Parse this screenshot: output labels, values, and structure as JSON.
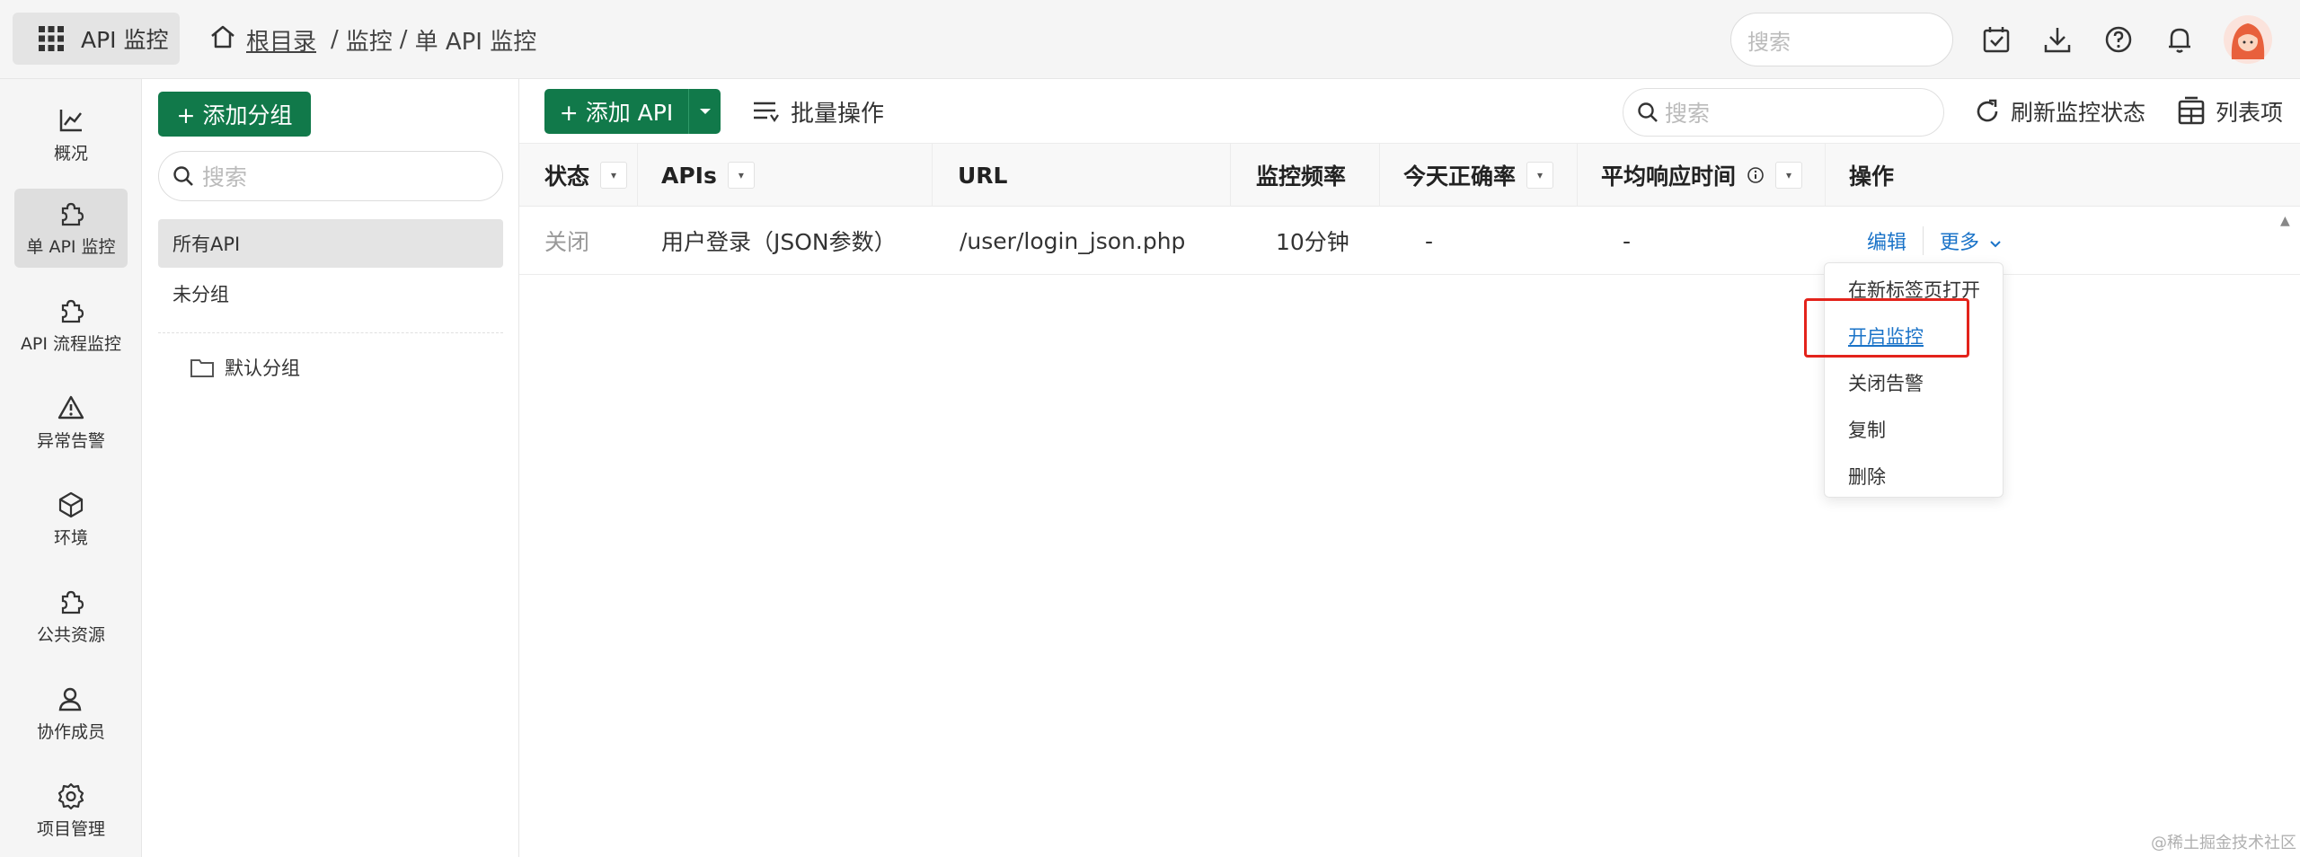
{
  "topbar": {
    "app_label": "API 监控",
    "breadcrumb": {
      "root": "根目录",
      "sep1": "/",
      "level1": "监控",
      "sep2": "/",
      "level2": "单 API 监控"
    },
    "search_placeholder": "搜索"
  },
  "leftnav": {
    "items": [
      {
        "label": "概况",
        "icon": "chart-icon"
      },
      {
        "label": "单 API 监控",
        "icon": "puzzle-icon"
      },
      {
        "label": "API 流程监控",
        "icon": "puzzle-icon"
      },
      {
        "label": "异常告警",
        "icon": "warning-icon"
      },
      {
        "label": "环境",
        "icon": "cube-icon"
      },
      {
        "label": "公共资源",
        "icon": "puzzle-icon"
      },
      {
        "label": "协作成员",
        "icon": "user-icon"
      },
      {
        "label": "项目管理",
        "icon": "gear-icon"
      }
    ]
  },
  "groups": {
    "add_label": "+ 添加分组",
    "search_placeholder": "搜索",
    "items": [
      "所有API",
      "未分组"
    ],
    "folder_label": "默认分组"
  },
  "toolbar": {
    "add_api_label": "+ 添加 API",
    "batch_label": "批量操作",
    "search_placeholder": "搜索",
    "refresh_label": "刷新监控状态",
    "columns_label": "列表项"
  },
  "table": {
    "headers": [
      "状态",
      "APIs",
      "URL",
      "监控频率",
      "今天正确率",
      "平均响应时间",
      "操作"
    ],
    "rows": [
      {
        "status": "关闭",
        "api": "用户登录（JSON参数）",
        "url": "/user/login_json.php",
        "frequency": "10分钟",
        "accuracy": "-",
        "avg_time": "-",
        "edit": "编辑",
        "more": "更多"
      }
    ]
  },
  "dropdown": {
    "items": [
      "在新标签页打开",
      "开启监控",
      "关闭告警",
      "复制",
      "删除"
    ]
  },
  "watermark": "@稀土掘金技术社区",
  "colors": {
    "primary_green": "#11794a",
    "link_blue": "#1a73c8",
    "highlight_red": "#e3231b"
  }
}
